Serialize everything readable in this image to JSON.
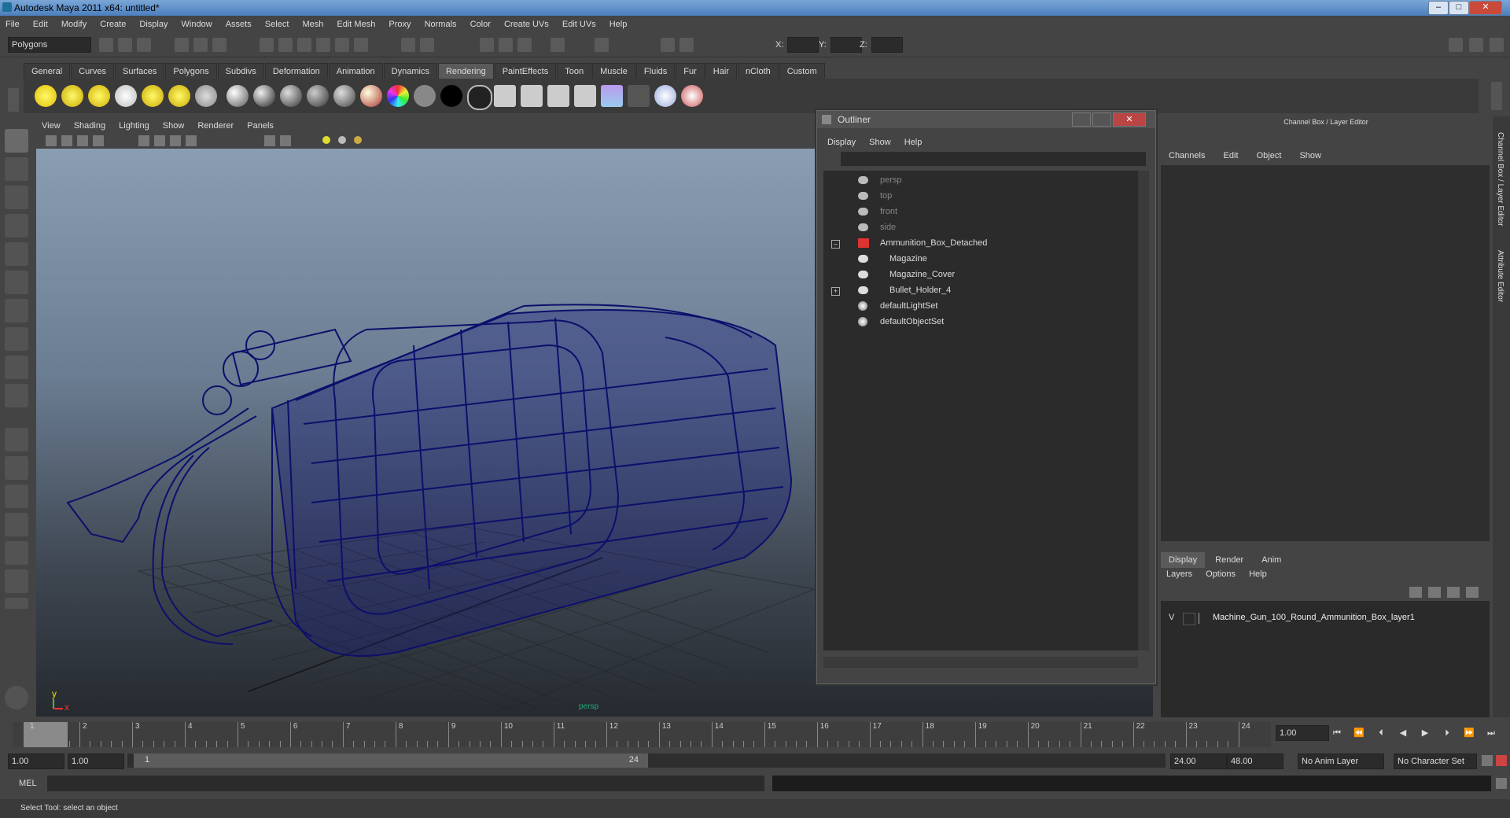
{
  "window": {
    "title": "Autodesk Maya 2011 x64: untitled*",
    "minimize": "–",
    "maximize": "□",
    "close": "✕"
  },
  "menubar": [
    "File",
    "Edit",
    "Modify",
    "Create",
    "Display",
    "Window",
    "Assets",
    "Select",
    "Mesh",
    "Edit Mesh",
    "Proxy",
    "Normals",
    "Color",
    "Create UVs",
    "Edit UVs",
    "Help"
  ],
  "status": {
    "mode": "Polygons",
    "x_label": "X:",
    "y_label": "Y:",
    "z_label": "Z:"
  },
  "shelf_tabs": [
    "General",
    "Curves",
    "Surfaces",
    "Polygons",
    "Subdivs",
    "Deformation",
    "Animation",
    "Dynamics",
    "Rendering",
    "PaintEffects",
    "Toon",
    "Muscle",
    "Fluids",
    "Fur",
    "Hair",
    "nCloth",
    "Custom"
  ],
  "shelf_active": "Rendering",
  "panel_menu": [
    "View",
    "Shading",
    "Lighting",
    "Show",
    "Renderer",
    "Panels"
  ],
  "viewport": {
    "camera_label": "persp",
    "axis_x": "x",
    "axis_y": "y",
    "wire_color": "#0d0f6b"
  },
  "outliner": {
    "title": "Outliner",
    "menu": [
      "Display",
      "Show",
      "Help"
    ],
    "items": [
      {
        "label": "persp",
        "dim": true
      },
      {
        "label": "top",
        "dim": true
      },
      {
        "label": "front",
        "dim": true
      },
      {
        "label": "side",
        "dim": true
      },
      {
        "label": "Ammunition_Box_Detached",
        "dim": false
      },
      {
        "label": "Magazine",
        "dim": false
      },
      {
        "label": "Magazine_Cover",
        "dim": false
      },
      {
        "label": "Bullet_Holder_4",
        "dim": false
      },
      {
        "label": "defaultLightSet",
        "dim": false
      },
      {
        "label": "defaultObjectSet",
        "dim": false
      }
    ]
  },
  "channel_box": {
    "title": "Channel Box / Layer Editor",
    "menu": [
      "Channels",
      "Edit",
      "Object",
      "Show"
    ],
    "layer_tabs": [
      "Display",
      "Render",
      "Anim"
    ],
    "layer_menu": [
      "Layers",
      "Options",
      "Help"
    ],
    "layer": {
      "visible": "V",
      "name": "Machine_Gun_100_Round_Ammunition_Box_layer1"
    },
    "side_tabs": [
      "Channel Box / Layer Editor",
      "Attribute Editor"
    ]
  },
  "timeline": {
    "ticks": [
      "1",
      "2",
      "3",
      "4",
      "5",
      "6",
      "7",
      "8",
      "9",
      "10",
      "11",
      "12",
      "13",
      "14",
      "15",
      "16",
      "17",
      "18",
      "19",
      "20",
      "21",
      "22",
      "23",
      "24"
    ],
    "current_frame": "1.00",
    "playback": [
      "⏮",
      "⏪",
      "⏴",
      "◀",
      "▶",
      "⏵",
      "⏩",
      "⏭"
    ]
  },
  "range": {
    "start": "1.00",
    "start2": "1.00",
    "slider_start": "1",
    "slider_end": "24",
    "end": "24.00",
    "end2": "48.00",
    "anim_layer": "No Anim Layer",
    "char_set": "No Character Set"
  },
  "command": {
    "label": "MEL"
  },
  "helpline": {
    "text": "Select Tool: select an object"
  }
}
